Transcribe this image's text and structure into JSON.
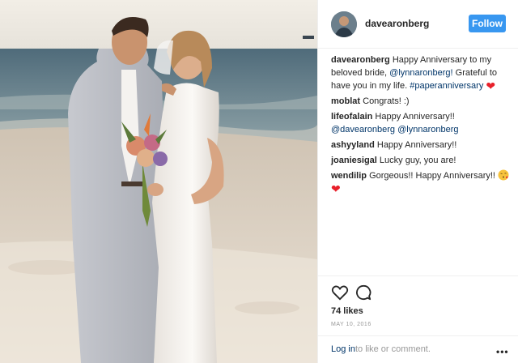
{
  "post": {
    "photo_alt": "couple on beach",
    "username": "davearonberg",
    "follow_label": "Follow",
    "caption": {
      "user": "davearonberg",
      "text_1": "Happy Anniversary to my beloved bride,",
      "mention": "@lynnaronberg!",
      "text_2": "Grateful to have you in my life.",
      "hashtag": "#paperanniversary"
    },
    "comments": [
      {
        "user": "moblat",
        "text": "Congrats! :)"
      },
      {
        "user": "lifeofalain",
        "text": "Happy Anniversary!!",
        "mention_1": "@davearonberg",
        "mention_2": "@lynnaronberg"
      },
      {
        "user": "ashyyland",
        "text": "Happy Anniversary!!"
      },
      {
        "user": "joaniesigal",
        "text": "Lucky guy, you are!"
      },
      {
        "user": "wendilip",
        "text": "Gorgeous!! Happy Anniversary!!"
      }
    ],
    "likes": "74 likes",
    "date": "MAY 10, 2016",
    "login_link": "Log in",
    "login_text": "to like or comment.",
    "more_label": "•••"
  },
  "icons": {
    "like": "heart-outline-icon",
    "comment": "speech-bubble-icon",
    "more": "more-options-icon",
    "heart_emoji": "red-heart-emoji",
    "kiss_emoji": "face-blowing-kiss-emoji"
  },
  "colors": {
    "follow_bg": "#3897f0",
    "link": "#003569",
    "heart": "#e8202a",
    "muted": "#999999"
  }
}
